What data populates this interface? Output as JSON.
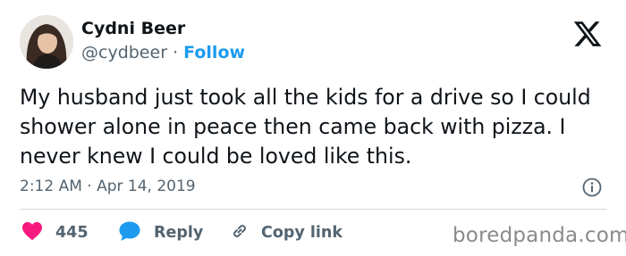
{
  "author": {
    "name": "Cydni Beer",
    "handle": "@cydbeer",
    "separator": "·",
    "follow_label": "Follow"
  },
  "tweet": {
    "text": "My husband just took all the kids for a drive so I could shower alone in peace then came back with pizza. I never knew I could be loved like this.",
    "time": "2:12 AM",
    "date_separator": "·",
    "date": "Apr 14, 2019"
  },
  "actions": {
    "like_count": "445",
    "reply_label": "Reply",
    "copy_link_label": "Copy link"
  },
  "watermark": "boredpanda.com",
  "icons": {
    "brand": "x-logo-icon",
    "info": "info-icon",
    "like": "heart-icon",
    "reply": "reply-bubble-icon",
    "copy": "link-icon"
  },
  "colors": {
    "like": "#f91880",
    "reply": "#1d9bf0",
    "follow": "#1d9bf0",
    "secondary_text": "#536471"
  }
}
